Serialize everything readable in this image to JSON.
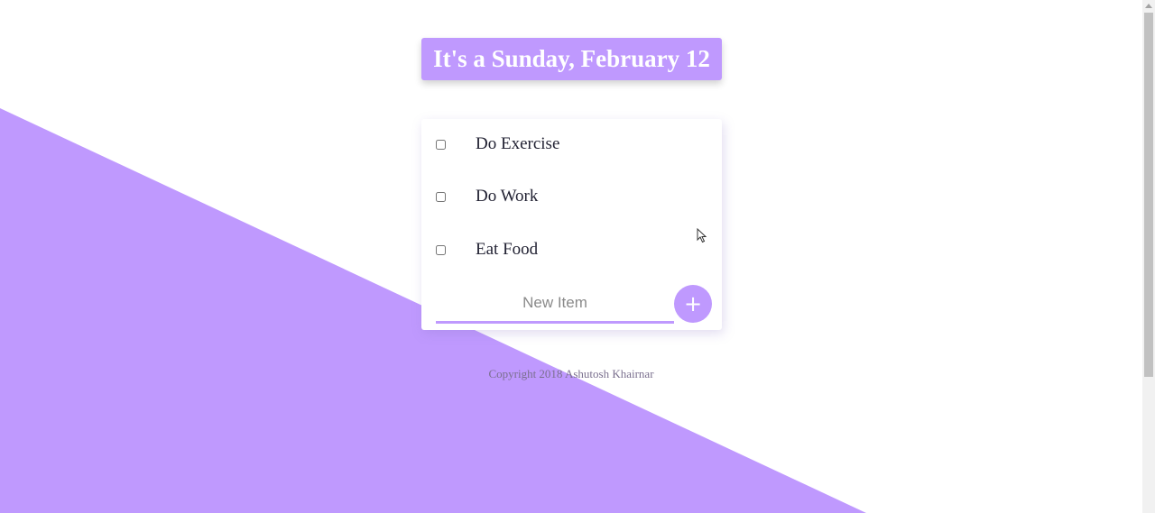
{
  "header": {
    "title": "It's a Sunday, February 12"
  },
  "todo_list": {
    "items": [
      {
        "label": "Do Exercise",
        "checked": false
      },
      {
        "label": "Do Work",
        "checked": false
      },
      {
        "label": "Eat Food",
        "checked": false
      }
    ],
    "new_item": {
      "placeholder": "New Item",
      "value": ""
    },
    "add_button_label": "+"
  },
  "footer": {
    "copyright": "Copyright 2018 Ashutosh Khairnar"
  },
  "colors": {
    "accent": "#bf99fe",
    "text": "#222233",
    "footer_text": "#7a6f8e"
  },
  "icons": {
    "add": "plus-icon",
    "cursor": "mouse-pointer-icon"
  }
}
